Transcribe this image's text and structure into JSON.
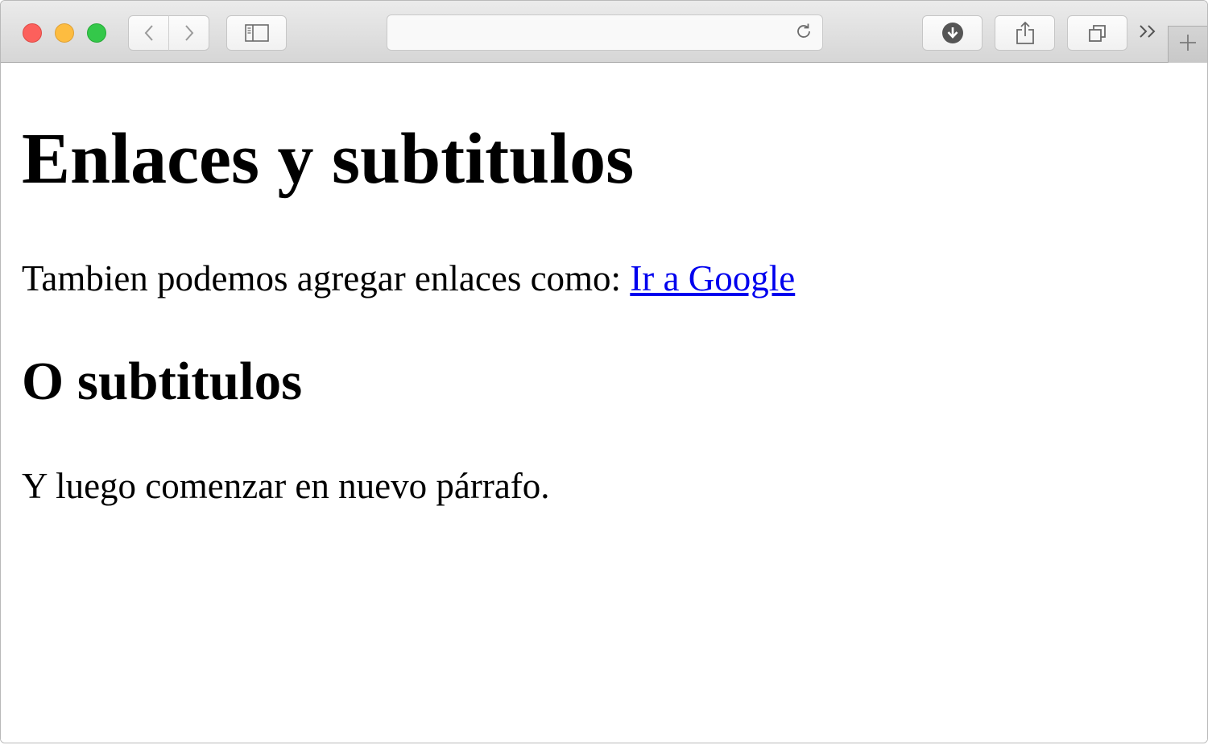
{
  "browser": {
    "address": {
      "value": "",
      "placeholder": ""
    },
    "icons": {
      "back": "chevron-left-icon",
      "forward": "chevron-right-icon",
      "sidebar": "sidebar-icon",
      "reload": "reload-icon",
      "download": "download-icon",
      "share": "share-icon",
      "tabs": "tabs-overview-icon",
      "more": "chevron-double-right-icon",
      "new_tab": "plus-icon"
    },
    "colors": {
      "close": "#fc605c",
      "minimize": "#fdbc40",
      "zoom": "#34c84a"
    }
  },
  "page": {
    "heading": "Enlaces y subtitulos",
    "paragraph1_text": "Tambien podemos agregar enlaces como: ",
    "link_text": "Ir a Google",
    "subheading": "O subtitulos",
    "paragraph2": "Y luego comenzar en nuevo párrafo.",
    "link_color": "#0000ee"
  }
}
